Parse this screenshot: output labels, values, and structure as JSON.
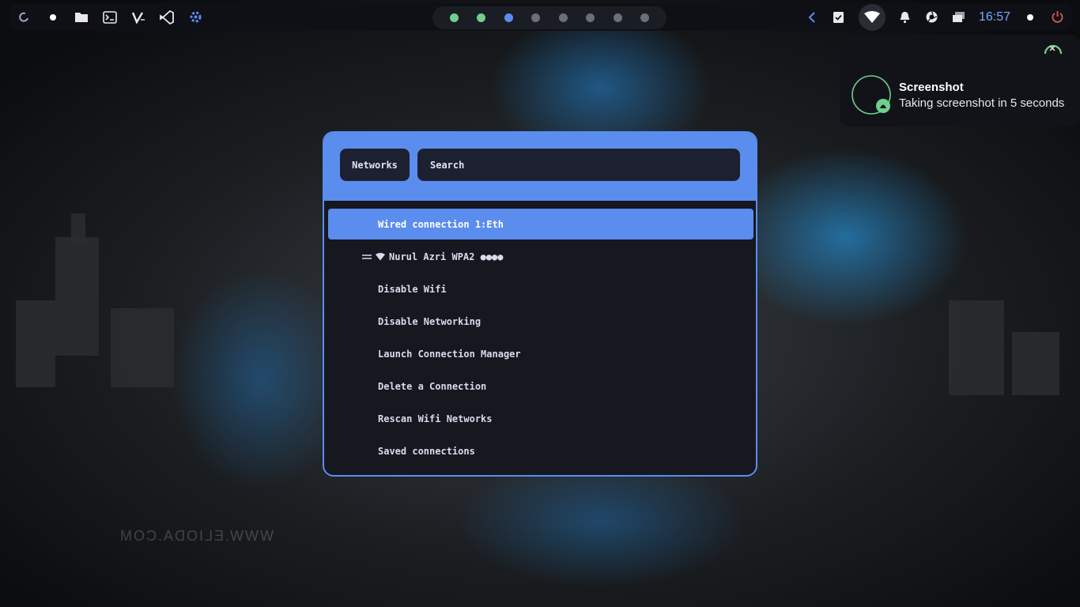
{
  "desktop": {
    "watermark": "WWW.ELIODA.COM"
  },
  "taskbar": {
    "launchers": [
      "debian-logo-icon",
      "dot-icon",
      "folder-icon",
      "terminal-icon",
      "vim-icon",
      "vscode-icon",
      "settings-gear-icon"
    ],
    "workspaces": [
      {
        "color": "#6fd08c"
      },
      {
        "color": "#6fd08c"
      },
      {
        "color": "#5b8def"
      },
      {
        "color": "#6b6f78"
      },
      {
        "color": "#6b6f78"
      },
      {
        "color": "#6b6f78"
      },
      {
        "color": "#6b6f78"
      },
      {
        "color": "#6b6f78"
      }
    ],
    "clock": "16:57",
    "tray": [
      "chevron-left-icon",
      "checklist-icon",
      "wifi-icon",
      "bell-icon",
      "camera-shutter-icon",
      "window-switch-icon",
      "status-dot-icon",
      "power-icon"
    ]
  },
  "notification": {
    "title": "Screenshot",
    "body": "Taking screenshot in 5 seconds"
  },
  "network_menu": {
    "mode_label": "Networks",
    "search_placeholder": "Search",
    "items": [
      {
        "label": "Wired connection 1:Eth",
        "selected": true
      },
      {
        "label": "Nurul Azri  WPA2  ●●●●",
        "connected": true
      },
      {
        "label": "Disable Wifi"
      },
      {
        "label": "Disable Networking"
      },
      {
        "label": "Launch Connection Manager"
      },
      {
        "label": "Delete a Connection"
      },
      {
        "label": "Rescan Wifi Networks"
      },
      {
        "label": "Saved connections"
      }
    ]
  },
  "colors": {
    "accent": "#5b8def",
    "menu_bg": "#16171f",
    "bar_bg": "#0f1015",
    "clock": "#79a9ff",
    "power": "#e05555"
  }
}
